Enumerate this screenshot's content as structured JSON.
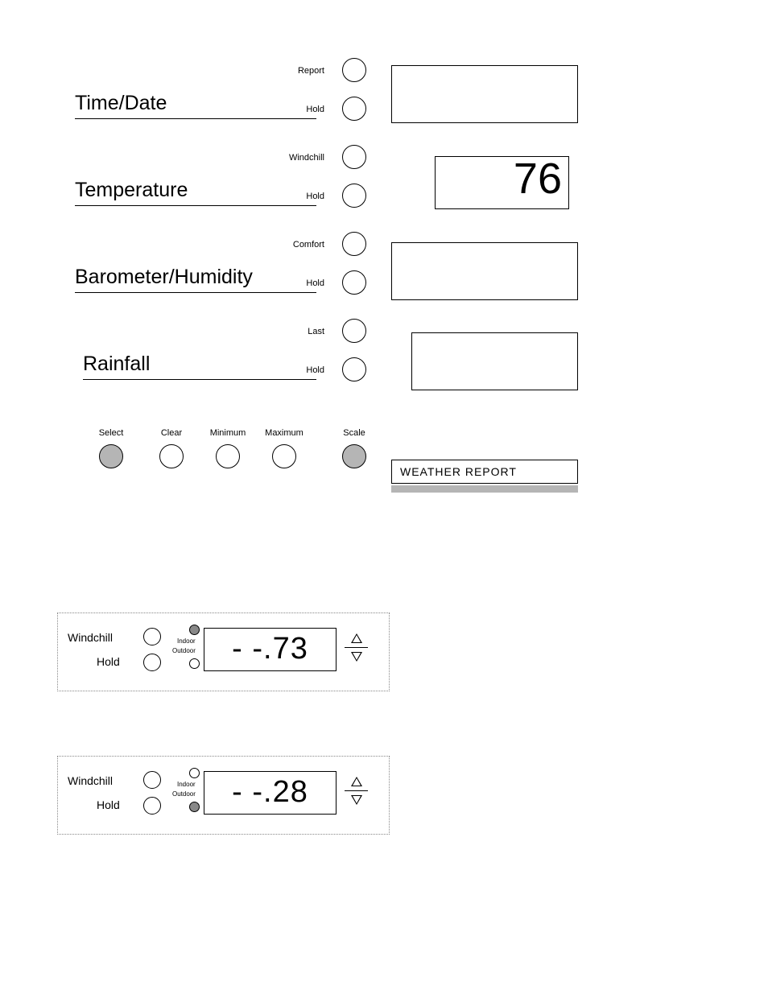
{
  "main": {
    "sections": [
      {
        "title": "Time/Date",
        "btn1_label": "Report",
        "btn2_label": "Hold"
      },
      {
        "title": "Temperature",
        "btn1_label": "Windchill",
        "btn2_label": "Hold",
        "display": "76"
      },
      {
        "title": "Barometer/Humidity",
        "btn1_label": "Comfort",
        "btn2_label": "Hold"
      },
      {
        "title": "Rainfall",
        "btn1_label": "Last",
        "btn2_label": "Hold"
      }
    ],
    "bottom": {
      "select": "Select",
      "clear": "Clear",
      "minimum": "Minimum",
      "maximum": "Maximum",
      "scale": "Scale"
    },
    "weather_report": "WEATHER REPORT"
  },
  "sub1": {
    "windchill": "Windchill",
    "hold": "Hold",
    "indoor": "Indoor",
    "outdoor": "Outdoor",
    "indoor_selected": true,
    "value": "- -.73"
  },
  "sub2": {
    "windchill": "Windchill",
    "hold": "Hold",
    "indoor": "Indoor",
    "outdoor": "Outdoor",
    "indoor_selected": false,
    "value": "- -.28"
  }
}
